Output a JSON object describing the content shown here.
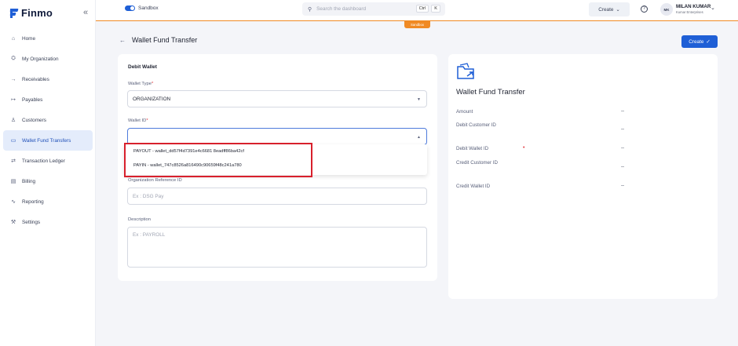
{
  "app": {
    "brand": "Finmo",
    "collapse_icon": "double-chevron-left-icon"
  },
  "sidebar": {
    "items": [
      {
        "label": "Home",
        "icon": "home-icon"
      },
      {
        "label": "My Organization",
        "icon": "organization-icon"
      },
      {
        "label": "Receivables",
        "icon": "receivables-icon"
      },
      {
        "label": "Payables",
        "icon": "payables-icon"
      },
      {
        "label": "Customers",
        "icon": "customers-icon"
      },
      {
        "label": "Wallet Fund Transfers",
        "icon": "wallet-icon",
        "active": true
      },
      {
        "label": "Transaction Ledger",
        "icon": "ledger-icon"
      },
      {
        "label": "Billing",
        "icon": "billing-icon"
      },
      {
        "label": "Reporting",
        "icon": "reporting-icon"
      },
      {
        "label": "Settings",
        "icon": "settings-icon"
      }
    ]
  },
  "topbar": {
    "sandbox_label": "Sandbox",
    "search_placeholder": "Search the dashboard",
    "shortcut_ctrl": "Ctrl",
    "shortcut_key": "K",
    "create_label": "Create",
    "user_initials": "MK",
    "user_name": "MILAN KUMAR",
    "user_org": "Kumar Enterprises",
    "sandbox_badge": "Sandbox"
  },
  "page": {
    "title": "Wallet Fund Transfer",
    "create_button": "Create"
  },
  "form": {
    "section_title": "Debit Wallet",
    "wallet_type_label": "Wallet Type",
    "wallet_type_value": "ORGANIZATION",
    "wallet_id_label": "Wallet ID",
    "wallet_id_options": [
      "PAYOUT - wallet_dd57f4d7391e4c6681 8eadff86ba42cf",
      "PAYIN - wallet_747c8526a816490c90659f48c241a780"
    ],
    "org_ref_label": "Organization Reference ID",
    "org_ref_placeholder": "Ex : DSG Pay",
    "description_label": "Description",
    "description_placeholder": "Ex : PAYROLL"
  },
  "summary": {
    "title": "Wallet Fund Transfer",
    "rows": [
      {
        "key": "Amount",
        "value": "--"
      },
      {
        "key": "Debit Customer ID",
        "value": "--"
      },
      {
        "key": "Debit Wallet ID",
        "value": "--"
      },
      {
        "key": "Credit Customer ID",
        "value": "--"
      },
      {
        "key": "Credit Wallet ID",
        "value": "--"
      }
    ]
  },
  "colors": {
    "brand": "#1f5fd6",
    "sandbox_orange": "#f08a24",
    "highlight_red": "#d8202c"
  }
}
